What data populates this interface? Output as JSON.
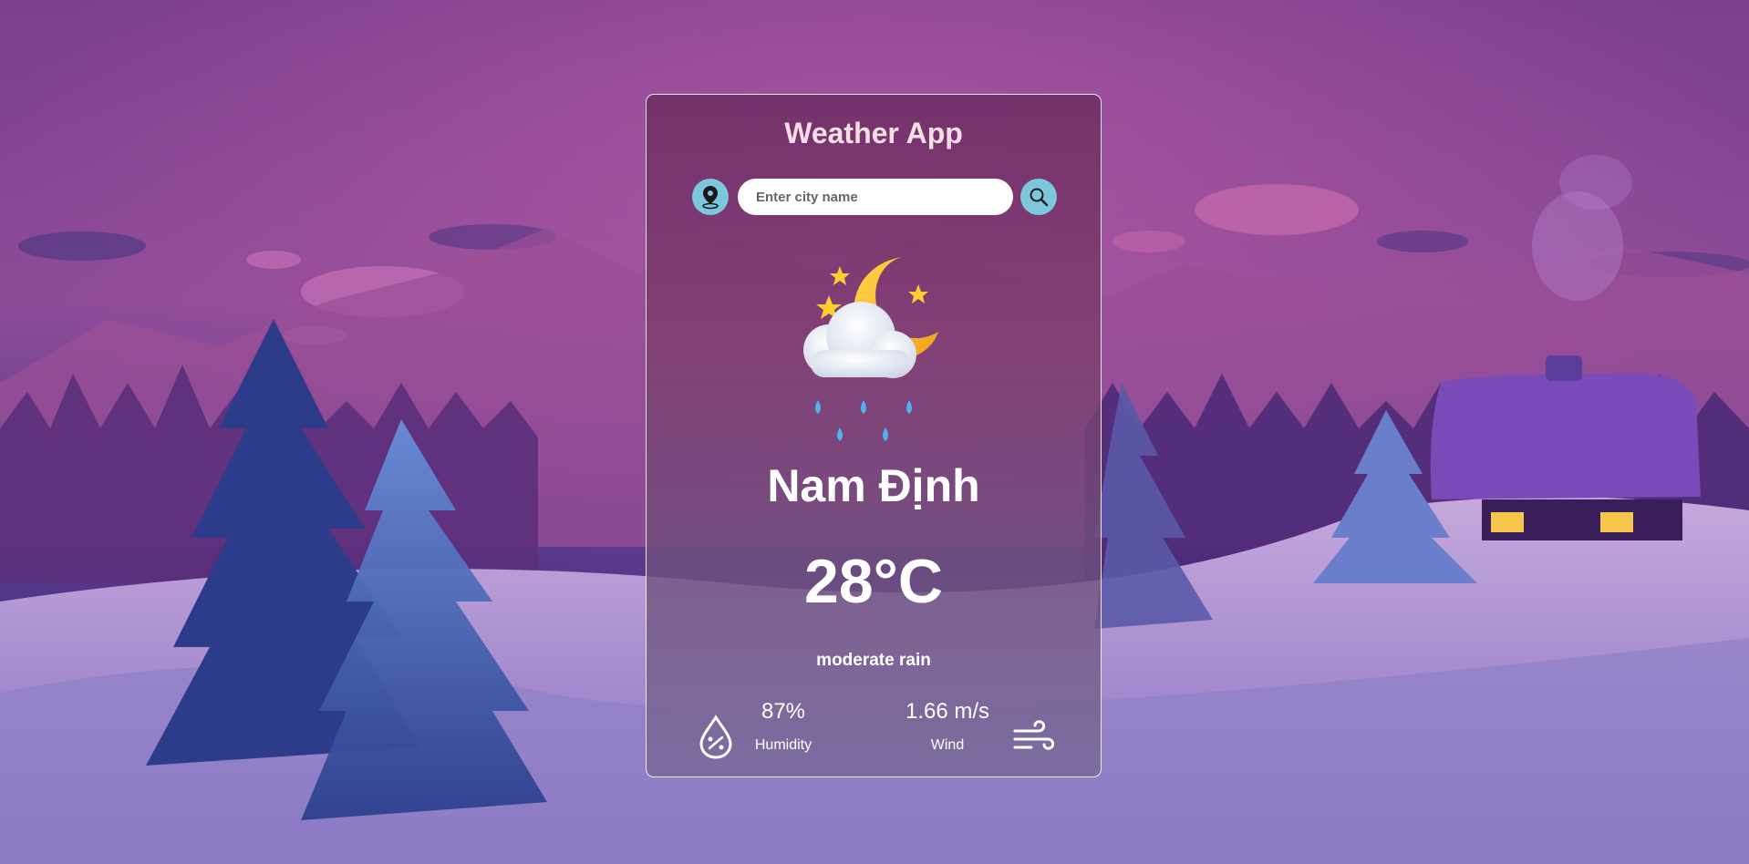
{
  "app": {
    "title": "Weather App"
  },
  "search": {
    "placeholder": "Enter city name",
    "value": ""
  },
  "weather": {
    "city": "Nam Định",
    "temperature": "28°C",
    "description": "moderate rain",
    "humidity_value": "87%",
    "humidity_label": "Humidity",
    "wind_value": "1.66 m/s",
    "wind_label": "Wind",
    "condition_icon": "moon-cloud-rain-icon"
  },
  "colors": {
    "accent": "#7cc7dc",
    "title": "#f6dfe4",
    "card_border": "#f3e9f2"
  }
}
